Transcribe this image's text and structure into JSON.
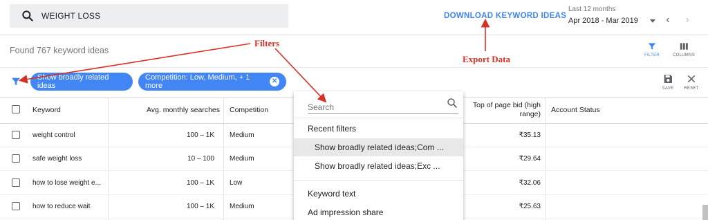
{
  "search": {
    "value": "WEIGHT LOSS"
  },
  "header": {
    "download_label": "DOWNLOAD KEYWORD IDEAS",
    "date_label": "Last 12 months",
    "date_value": "Apr 2018 - Mar 2019"
  },
  "results": {
    "found_text": "Found 767 keyword ideas"
  },
  "tools": {
    "filter": "FILTER",
    "columns": "COLUMNS",
    "save": "SAVE",
    "reset": "RESET"
  },
  "chips": [
    {
      "label": "Show broadly related ideas"
    },
    {
      "label": "Competition: Low, Medium, + 1 more"
    }
  ],
  "table": {
    "headers": [
      "Keyword",
      "Avg. monthly searches",
      "Competition",
      "Top of page bid (high range)",
      "Account Status"
    ],
    "rows": [
      {
        "keyword": "weight control",
        "searches": "100 – 1K",
        "competition": "Medium",
        "bid": "₹35.13"
      },
      {
        "keyword": "safe weight loss",
        "searches": "10 – 100",
        "competition": "Medium",
        "bid": "₹29.64"
      },
      {
        "keyword": "how to lose weight e...",
        "searches": "100 – 1K",
        "competition": "Low",
        "bid": "₹32.06"
      },
      {
        "keyword": "how to reduce wait",
        "searches": "100 – 1K",
        "competition": "Medium",
        "bid": "₹25.63"
      }
    ]
  },
  "dropdown": {
    "search_placeholder": "Search",
    "recent_heading": "Recent filters",
    "recent": [
      "Show broadly related ideas;Com ...",
      "Show broadly related ideas;Exc ..."
    ],
    "options": [
      "Keyword text",
      "Ad impression share"
    ]
  },
  "annotations": {
    "filters": "Filters",
    "export": "Export Data"
  },
  "colors": {
    "accent": "#4285f4",
    "annotation": "#d93025"
  }
}
